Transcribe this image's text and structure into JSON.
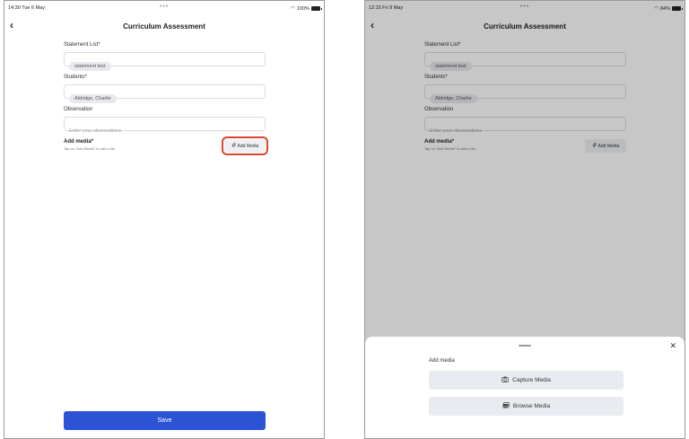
{
  "left": {
    "status": {
      "time": "14:30  Tue 6 May",
      "battery": "100%"
    },
    "nav_title": "Curriculum Assessment",
    "statement_label": "Statement List*",
    "statement_chip": "statement test",
    "students_label": "Students*",
    "students_chip": "Aldridge, Charlie",
    "observation_label": "Observation",
    "observation_placeholder": "Enter your observations",
    "media_title": "Add media*",
    "media_hint": "Tap on \"Add Media\" to add a file.",
    "add_media_label": "Add Media",
    "save_label": "Save"
  },
  "right": {
    "status": {
      "time": "12:15  Fri 9 May",
      "battery": "84%"
    },
    "nav_title": "Curriculum Assessment",
    "statement_label": "Statement List*",
    "statement_chip": "statement test",
    "students_label": "Students*",
    "students_chip": "Aldridge, Charlie",
    "observation_label": "Observation",
    "observation_placeholder": "Enter your observations",
    "media_title": "Add media*",
    "media_hint": "Tap on \"Add Media\" to add a file.",
    "add_media_label": "Add Media",
    "sheet": {
      "title": "Add media",
      "capture_label": "Capture Media",
      "browse_label": "Browse Media"
    }
  },
  "icons": {
    "wifi": "wifi-icon",
    "battery": "battery-icon",
    "back": "chevron-left-icon",
    "paperclip": "paperclip-icon",
    "close": "close-icon",
    "camera": "camera-icon",
    "gallery": "gallery-icon"
  },
  "colors": {
    "primary": "#2c53d6",
    "highlight": "#d9452f",
    "chip_bg": "#e7e9ee"
  }
}
